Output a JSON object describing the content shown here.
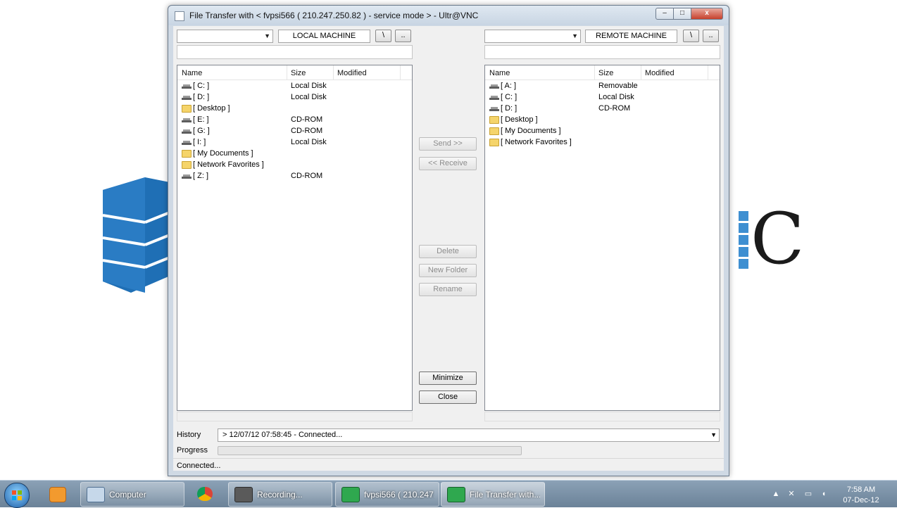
{
  "window": {
    "title": "File Transfer with < fvpsi566 ( 210.247.250.82 ) - service mode >  -  Ultr@VNC",
    "min_glyph": "–",
    "max_glyph": "□",
    "close_glyph": "x"
  },
  "local": {
    "label": "LOCAL MACHINE",
    "root_button": "\\",
    "up_button": "..",
    "columns": [
      "Name",
      "Size",
      "Modified"
    ],
    "rows": [
      {
        "name": "[ C: ]",
        "size": "Local Disk",
        "icon": "drive-icon"
      },
      {
        "name": "[ D: ]",
        "size": "Local Disk",
        "icon": "drive-icon"
      },
      {
        "name": "[ Desktop ]",
        "size": "",
        "icon": "folder-icon"
      },
      {
        "name": "[ E: ]",
        "size": "CD-ROM",
        "icon": "drive-icon"
      },
      {
        "name": "[ G: ]",
        "size": "CD-ROM",
        "icon": "drive-icon"
      },
      {
        "name": "[ I: ]",
        "size": "Local Disk",
        "icon": "drive-icon"
      },
      {
        "name": "[ My Documents ]",
        "size": "",
        "icon": "folder-icon"
      },
      {
        "name": "[ Network Favorites ]",
        "size": "",
        "icon": "folder-icon"
      },
      {
        "name": "[ Z: ]",
        "size": "CD-ROM",
        "icon": "drive-icon"
      }
    ]
  },
  "remote": {
    "label": "REMOTE MACHINE",
    "root_button": "\\",
    "up_button": "..",
    "columns": [
      "Name",
      "Size",
      "Modified"
    ],
    "rows": [
      {
        "name": "[ A: ]",
        "size": "Removable",
        "icon": "drive-icon"
      },
      {
        "name": "[ C: ]",
        "size": "Local Disk",
        "icon": "drive-icon"
      },
      {
        "name": "[ D: ]",
        "size": "CD-ROM",
        "icon": "drive-icon"
      },
      {
        "name": "[ Desktop ]",
        "size": "",
        "icon": "folder-icon"
      },
      {
        "name": "[ My Documents ]",
        "size": "",
        "icon": "folder-icon"
      },
      {
        "name": "[ Network Favorites ]",
        "size": "",
        "icon": "folder-icon"
      }
    ]
  },
  "actions": {
    "send": "Send >>",
    "receive": "<< Receive",
    "delete": "Delete",
    "new_folder": "New Folder",
    "rename": "Rename",
    "minimize": "Minimize",
    "close": "Close"
  },
  "history": {
    "label": "History",
    "value": "> 12/07/12 07:58:45 - Connected..."
  },
  "progress": {
    "label": "Progress",
    "fraction": 0.0
  },
  "status": "Connected...",
  "taskbar": {
    "tasks": [
      {
        "label": "Computer",
        "icon": "computer-icon"
      },
      {
        "label": "Recording...",
        "icon": "recording-icon"
      },
      {
        "label": "fvpsi566 ( 210.247....",
        "icon": "ultravnc-icon"
      },
      {
        "label": "File Transfer with...",
        "icon": "ultravnc-icon"
      }
    ],
    "clock_time": "7:58 AM",
    "clock_date": "07-Dec-12"
  },
  "colors": {
    "progress_fill": "#3fb24a",
    "logo_blue": "#1f6fb5"
  }
}
